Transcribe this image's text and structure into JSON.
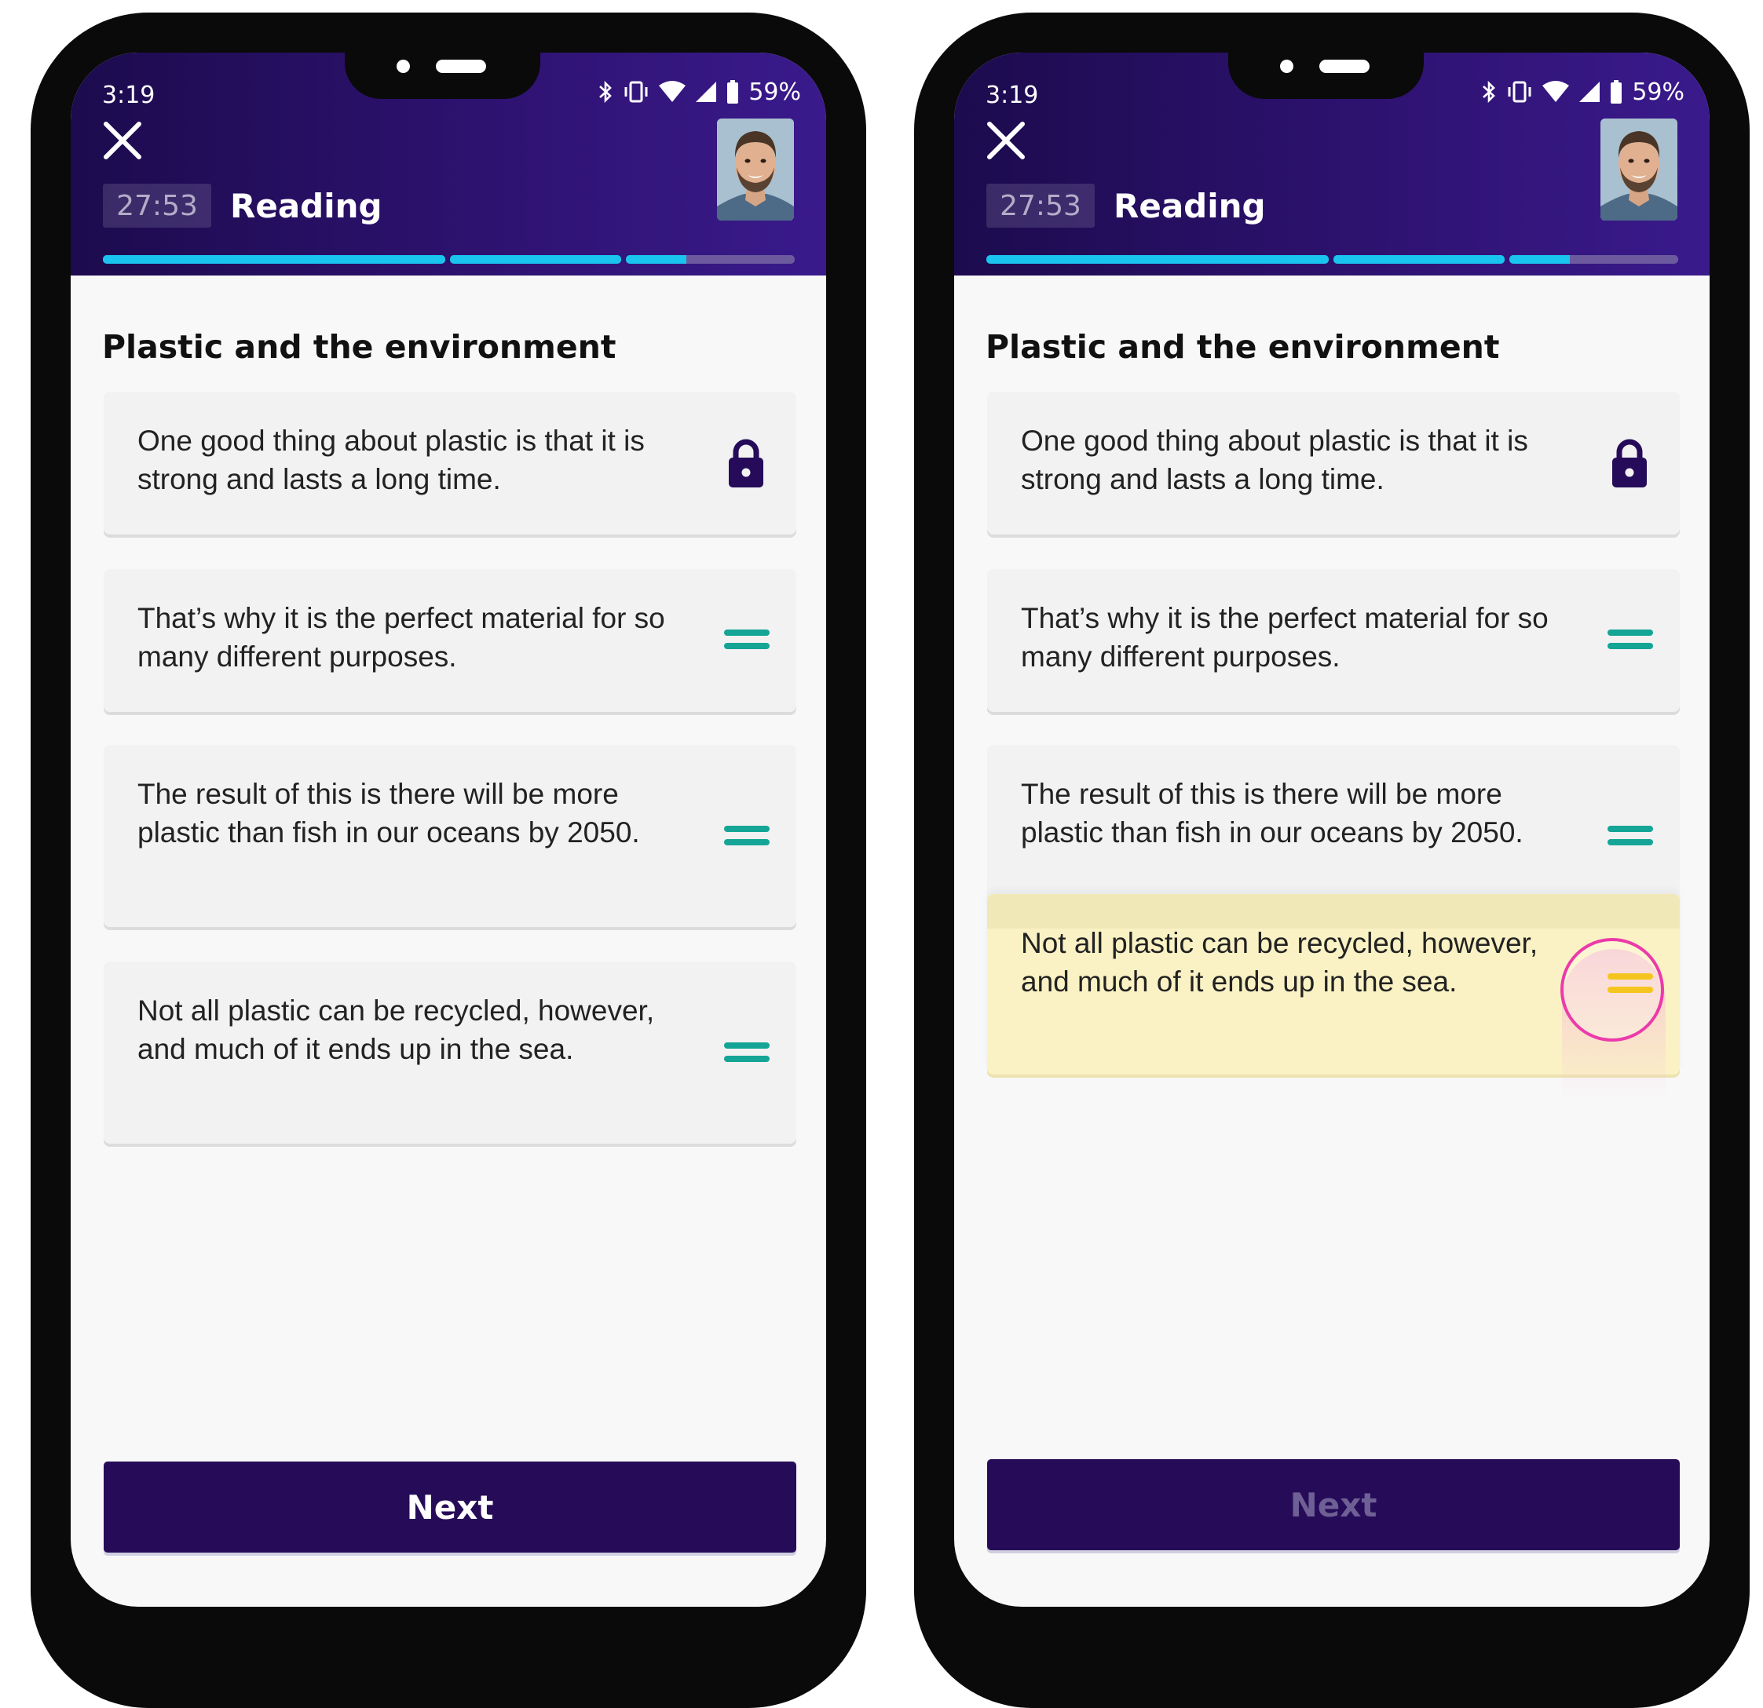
{
  "status": {
    "time": "3:19",
    "battery": "59%"
  },
  "header": {
    "timer": "27:53",
    "section": "Reading"
  },
  "progress": [
    1.0,
    1.0,
    0.36
  ],
  "question_title": "Plastic and the environment",
  "sentences": [
    "One good thing about plastic is that it is strong and lasts a long time.",
    "That’s why it is the perfect material for so many different purposes.",
    "The result of this is there will be more plastic than fish in our oceans by 2050.",
    "Not all plastic can be recycled, however, and much of it ends up in the sea."
  ],
  "next_label": "Next",
  "colors": {
    "accent_teal": "#15a596",
    "lock_purple": "#250b59",
    "drag_active": "#f5c51f",
    "touch_ring": "#ec3aaa",
    "progress_blue": "#19c4ef"
  },
  "icons": [
    "close-icon",
    "lock-icon",
    "drag-handle-icon",
    "bluetooth-icon",
    "vibrate-icon",
    "wifi-icon",
    "signal-icon",
    "battery-icon"
  ]
}
